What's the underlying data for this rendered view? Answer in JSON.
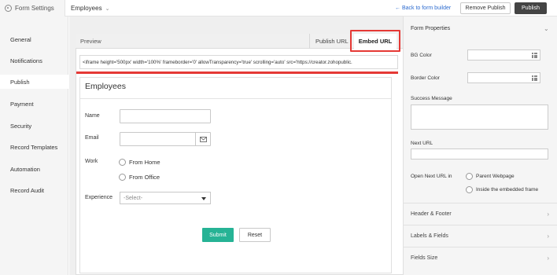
{
  "header": {
    "form_settings_label": "Form Settings",
    "form_name": "Employees",
    "back_link": "← Back to form builder",
    "remove_publish_label": "Remove Publish",
    "publish_label": "Publish"
  },
  "sidebar": {
    "items": [
      {
        "label": "General"
      },
      {
        "label": "Notifications"
      },
      {
        "label": "Publish"
      },
      {
        "label": "Payment"
      },
      {
        "label": "Security"
      },
      {
        "label": "Record Templates"
      },
      {
        "label": "Automation"
      },
      {
        "label": "Record Audit"
      }
    ],
    "active": "Publish"
  },
  "tabs": {
    "preview": "Preview",
    "publish_url": "Publish URL",
    "embed_url": "Embed URL"
  },
  "embed_code": "<iframe height='500px' width='100%' frameborder='0' allowTransparency='true' scrolling='auto' src='https://creator.zohopublic.",
  "form": {
    "title": "Employees",
    "name_label": "Name",
    "email_label": "Email",
    "work_label": "Work",
    "work_options": [
      "From Home",
      "From Office"
    ],
    "experience_label": "Experience",
    "experience_value": "-Select-",
    "submit_label": "Submit",
    "reset_label": "Reset"
  },
  "properties": {
    "title": "Form Properties",
    "bg_color_label": "BG Color",
    "border_color_label": "Border Color",
    "success_message_label": "Success Message",
    "next_url_label": "Next URL",
    "open_next_url_label": "Open Next URL in",
    "open_options": [
      "Parent Webpage",
      "Inside the embedded frame"
    ],
    "sections": [
      "Header & Footer",
      "Labels & Fields",
      "Fields Size"
    ]
  },
  "colors": {
    "accent_red": "#e53935",
    "submit_green": "#26b395",
    "link_blue": "#2d6bcf"
  }
}
